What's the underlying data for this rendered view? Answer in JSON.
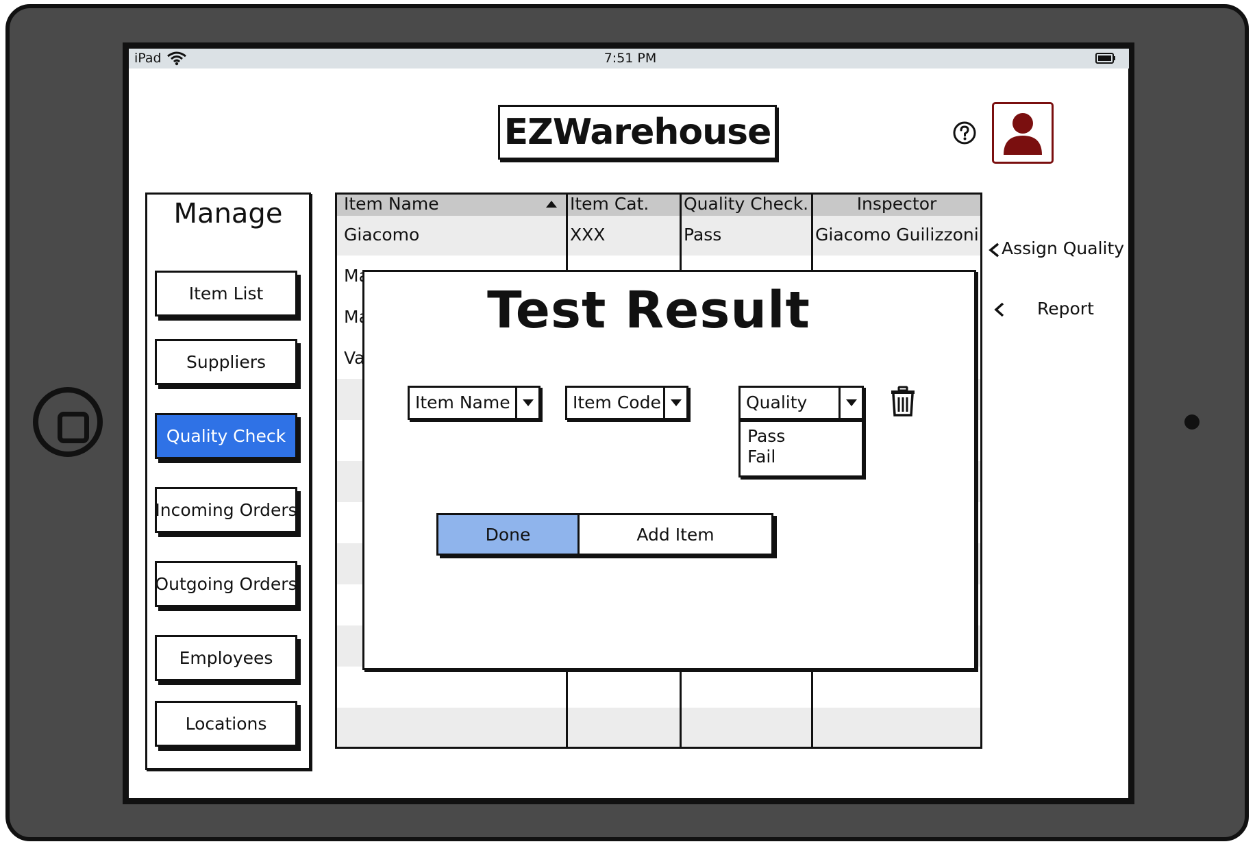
{
  "status_bar": {
    "device": "iPad",
    "time": "7:51 PM"
  },
  "header": {
    "app_title": "EZWarehouse"
  },
  "sidebar": {
    "title": "Manage",
    "items": [
      {
        "label": "Item List"
      },
      {
        "label": "Suppliers"
      },
      {
        "label": "Quality Check"
      },
      {
        "label": "Incoming Orders"
      },
      {
        "label": "Outgoing Orders"
      },
      {
        "label": "Employees"
      },
      {
        "label": "Locations"
      }
    ],
    "active_index": 2,
    "active_color": "#2f72e6"
  },
  "table": {
    "columns": [
      "Item Name",
      "Item Cat.",
      "Quality Check.",
      "Inspector"
    ],
    "sort_column": "Item Name",
    "rows": [
      {
        "item_name": "Giacomo",
        "item_cat": "XXX",
        "quality": "Pass",
        "inspector": "Giacomo Guilizzoni"
      },
      {
        "item_name": "Ma",
        "item_cat": "",
        "quality": "",
        "inspector": ""
      },
      {
        "item_name": "Ma",
        "item_cat": "",
        "quality": "",
        "inspector": ""
      },
      {
        "item_name": "Va",
        "item_cat": "",
        "quality": "",
        "inspector": ""
      }
    ]
  },
  "dialog": {
    "title": "Test Result",
    "item_name_select": "Item Name",
    "item_code_select": "Item Code",
    "quality_select": "Quality",
    "quality_options": [
      "Pass",
      "Fail"
    ],
    "done_label": "Done",
    "add_item_label": "Add Item"
  },
  "side_links": {
    "assign_quality": "Assign Quality",
    "report": "Report"
  },
  "colors": {
    "frame": "#4a4a4a",
    "status_bar": "#dbe1e5",
    "done_button": "#8fb4ec",
    "avatar": "#7a0f0f",
    "row_stripe": "#ececec"
  }
}
